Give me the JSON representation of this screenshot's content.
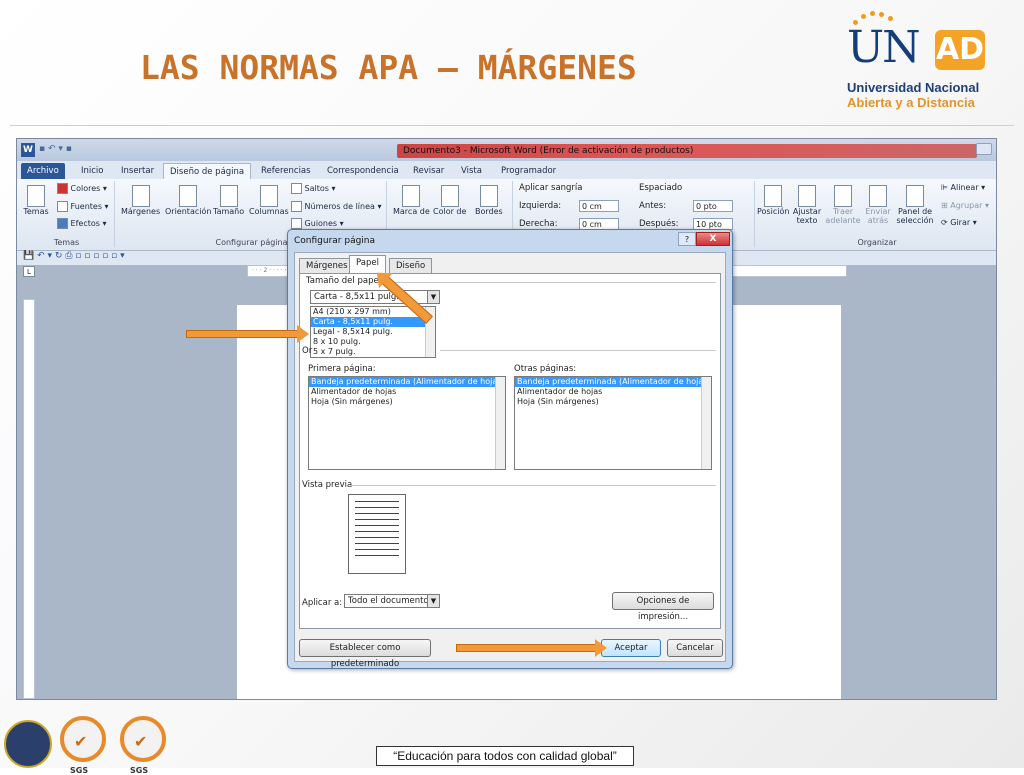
{
  "slide": {
    "title": "LAS NORMAS APA – MÁRGENES",
    "footer_motto": "“Educación para todos con calidad global”",
    "logo": {
      "letters_u_n": "UN",
      "letters_ad": "AD",
      "line1": "Universidad Nacional",
      "line2": "Abierta y a Distancia"
    },
    "badge_text": "SGS"
  },
  "word": {
    "window_title": "Documento3 - Microsoft Word (Error de activación de productos)",
    "tabs": [
      "Archivo",
      "Inicio",
      "Insertar",
      "Diseño de página",
      "Referencias",
      "Correspondencia",
      "Revisar",
      "Vista",
      "Programador"
    ],
    "active_tab": "Diseño de página",
    "ribbon": {
      "temas_group": "Temas",
      "temas_btn": "Temas",
      "colores": "Colores",
      "fuentes": "Fuentes",
      "efectos": "Efectos",
      "margenes": "Márgenes",
      "orientacion": "Orientación",
      "tamano": "Tamaño",
      "columnas": "Columnas",
      "saltos": "Saltos",
      "numeros_linea": "Números de línea",
      "guiones": "Guiones",
      "configurar_group": "Configurar página",
      "marca_agua": "Marca de",
      "color_pagina": "Color de",
      "bordes": "Bordes",
      "aplicar_sangria": "Aplicar sangría",
      "izquierda": "Izquierda:",
      "izquierda_val": "0 cm",
      "derecha": "Derecha:",
      "derecha_val": "0 cm",
      "espaciado": "Espaciado",
      "antes": "Antes:",
      "antes_val": "0 pto",
      "despues": "Después:",
      "despues_val": "10 pto",
      "posicion": "Posición",
      "ajustar_texto": "Ajustar texto",
      "traer_adelante": "Traer adelante",
      "enviar_atras": "Enviar atrás",
      "panel_seleccion": "Panel de selección",
      "alinear": "Alinear",
      "agrupar": "Agrupar",
      "girar": "Girar",
      "organizar_group": "Organizar"
    },
    "ruler_text": "· · · 2 · · ·                                                                             · · · 16 · · · 17 · · ·"
  },
  "dialog": {
    "title": "Configurar página",
    "help": "?",
    "close": "X",
    "tabs": [
      "Márgenes",
      "Papel",
      "Diseño"
    ],
    "active_tab": "Papel",
    "paper_size_label": "Tamaño del papel:",
    "paper_size_value": "Carta - 8,5x11 pulg.",
    "paper_size_options": [
      "A4 (210 x 297 mm)",
      "Carta - 8,5x11 pulg.",
      "Legal - 8,5x14 pulg.",
      "8 x 10 pulg.",
      "5 x 7 pulg."
    ],
    "paper_size_selected_index": 1,
    "hidden_label_fragment": "Or",
    "first_page_label": "Primera página:",
    "other_pages_label": "Otras páginas:",
    "first_page_options": [
      "Bandeja predeterminada (Alimentador de hojas)",
      "Alimentador de hojas",
      "Hoja (Sin márgenes)"
    ],
    "other_pages_options": [
      "Bandeja predeterminada (Alimentador de hojas)",
      "Alimentador de hojas",
      "Hoja (Sin márgenes)"
    ],
    "preview_label": "Vista previa",
    "apply_to_label": "Aplicar a:",
    "apply_to_value": "Todo el documento",
    "print_options_btn": "Opciones de impresión...",
    "set_default_btn": "Establecer como predeterminado",
    "ok_btn": "Aceptar",
    "cancel_btn": "Cancelar"
  },
  "colors": {
    "title_orange": "#c9722a",
    "arrow_orange": "#f29a3a",
    "word_blue": "#2b5797",
    "selection_blue": "#3399ff"
  }
}
